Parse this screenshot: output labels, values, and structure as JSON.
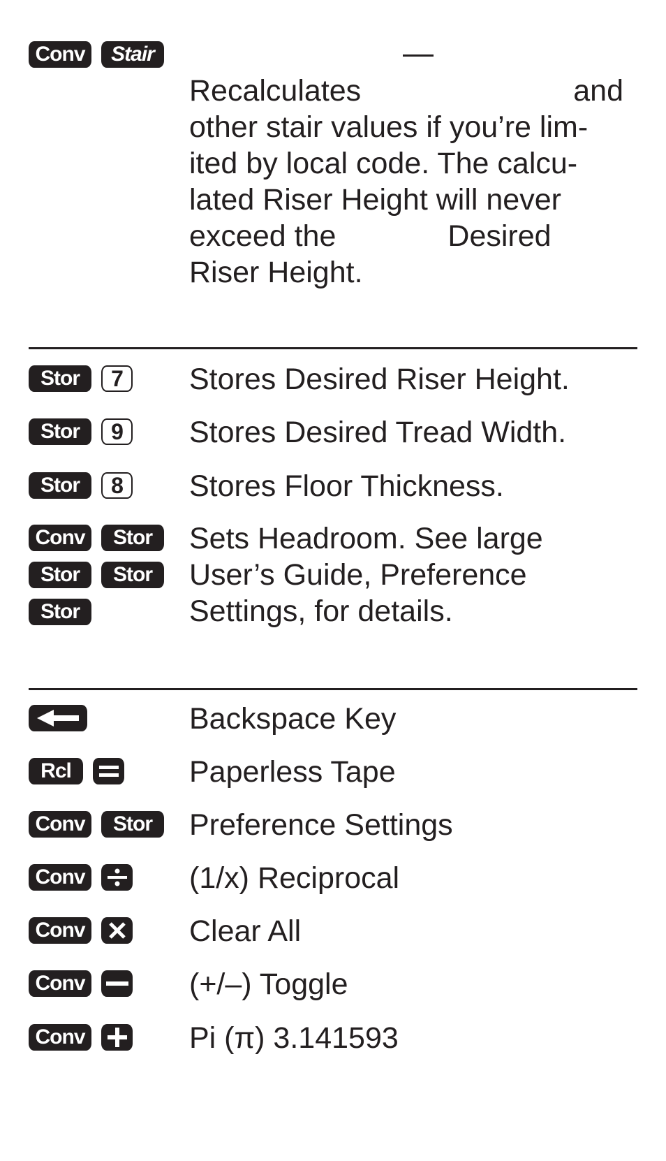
{
  "section_stair": {
    "keys": [
      "Conv",
      "Stair"
    ],
    "dash": "—",
    "lines": [
      {
        "left": "Recalculates",
        "right": "and"
      },
      {
        "text": "other stair values if you’re lim-"
      },
      {
        "text": "ited by local code. The calcu-"
      },
      {
        "text": "lated Riser Height will never"
      },
      {
        "left": "exceed the",
        "right": "Desired"
      },
      {
        "text": "Riser Height."
      }
    ]
  },
  "section_store": [
    {
      "keys": [
        "Stor",
        "7"
      ],
      "description": "Stores Desired Riser Height."
    },
    {
      "keys": [
        "Stor",
        "9"
      ],
      "description": "Stores Desired Tread Width."
    },
    {
      "keys": [
        "Stor",
        "8"
      ],
      "description": "Stores Floor Thickness."
    },
    {
      "keys": [
        "Conv",
        "Stor",
        "Stor",
        "Stor",
        "Stor"
      ],
      "description_lines": [
        "Sets Headroom. See large",
        "User’s Guide, Preference",
        "Settings, for details."
      ]
    }
  ],
  "section_functions": [
    {
      "keys": [
        "backspace-arrow"
      ],
      "description": "Backspace Key"
    },
    {
      "keys": [
        "Rcl",
        "equals"
      ],
      "description": "Paperless Tape"
    },
    {
      "keys": [
        "Conv",
        "Stor"
      ],
      "description": "Preference Settings"
    },
    {
      "keys": [
        "Conv",
        "divide"
      ],
      "description": "(1/x) Reciprocal"
    },
    {
      "keys": [
        "Conv",
        "multiply"
      ],
      "description": "Clear All"
    },
    {
      "keys": [
        "Conv",
        "minus"
      ],
      "description": "(+/–) Toggle"
    },
    {
      "keys": [
        "Conv",
        "plus"
      ],
      "description": "Pi (π) 3.141593"
    }
  ]
}
